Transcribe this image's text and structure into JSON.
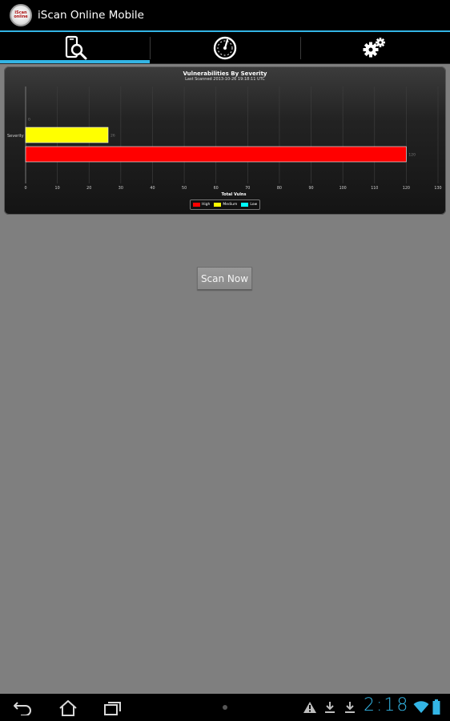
{
  "app": {
    "title": "iScan Online Mobile",
    "logo_text_top": "iScan",
    "logo_text_bottom": "online"
  },
  "tabs": [
    {
      "name": "scan",
      "icon": "phone-search-icon",
      "active": true
    },
    {
      "name": "dashboard",
      "icon": "gauge-icon",
      "active": false
    },
    {
      "name": "settings",
      "icon": "gears-icon",
      "active": false
    }
  ],
  "chart_data": {
    "type": "bar",
    "orientation": "horizontal",
    "title": "Vulnerabilities By Severity",
    "subtitle": "Last Scanned 2013-10-26 19:18:11 UTC",
    "ylabel": "Severity",
    "xlabel": "Total Vulns",
    "xlim": [
      0,
      130
    ],
    "xticks": [
      0,
      10,
      20,
      30,
      40,
      50,
      60,
      70,
      80,
      90,
      100,
      110,
      120,
      130
    ],
    "grid": true,
    "legend": "bottom-center",
    "series": [
      {
        "name": "High",
        "value": 120,
        "color": "#ff0000"
      },
      {
        "name": "Medium",
        "value": 26,
        "color": "#ffff00"
      },
      {
        "name": "Low",
        "value": 0,
        "color": "#00ffff"
      }
    ],
    "value_labels": [
      "120",
      "26",
      "0"
    ]
  },
  "scan_button": {
    "label": "Scan Now"
  },
  "system_bar": {
    "clock": "2:18",
    "icons": [
      "back-icon",
      "home-icon",
      "recent-apps-icon",
      "warning-icon",
      "download-icon",
      "download-icon",
      "wifi-icon",
      "battery-icon"
    ]
  },
  "colors": {
    "accent": "#33b5e5",
    "background": "#7f7f7f"
  }
}
